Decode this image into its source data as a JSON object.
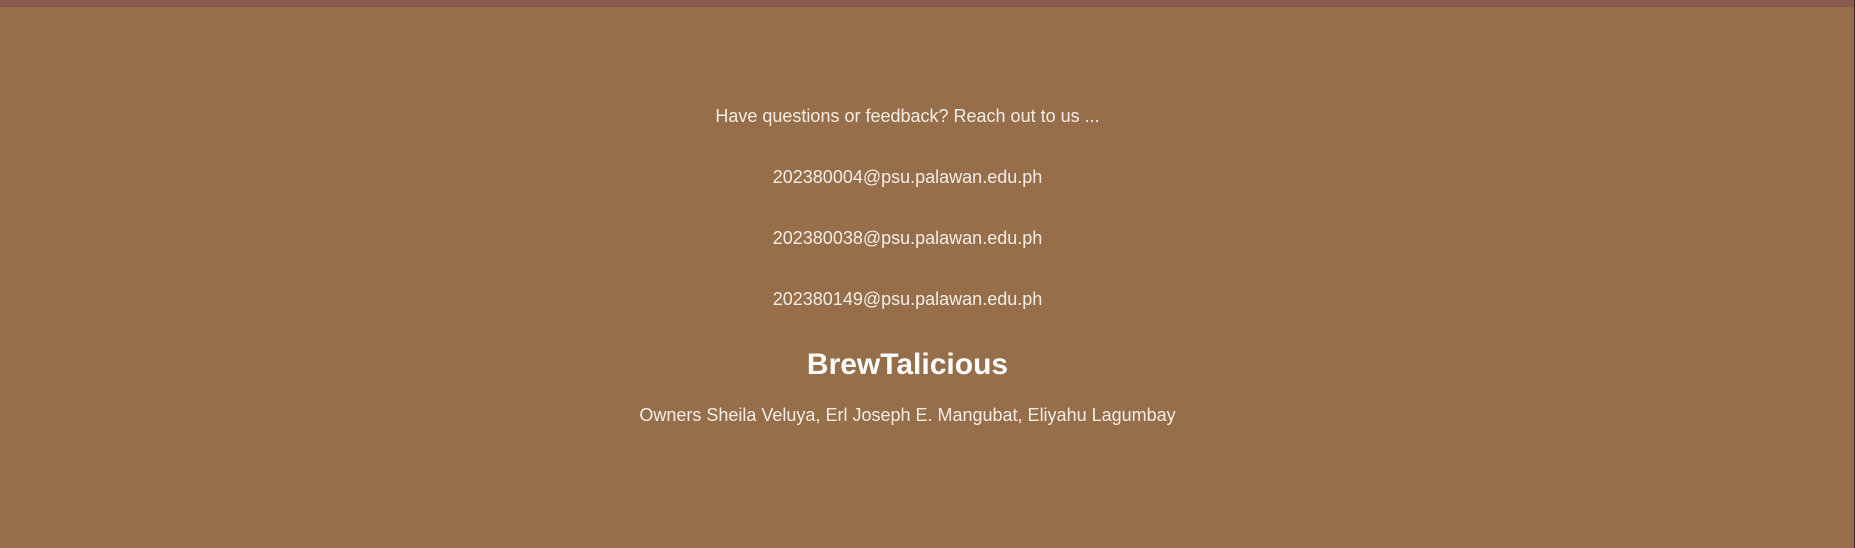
{
  "footer": {
    "contact_prompt": "Have questions or feedback? Reach out to us ...",
    "emails": [
      "202380004@psu.palawan.edu.ph",
      "202380038@psu.palawan.edu.ph",
      "202380149@psu.palawan.edu.ph"
    ],
    "brand_name": "BrewTalicious",
    "owners": "Owners Sheila Veluya, Erl Joseph E. Mangubat, Eliyahu Lagumbay"
  },
  "colors": {
    "background": "#966e4a",
    "top_strip": "#8a5a50",
    "text": "#f4ede6"
  }
}
